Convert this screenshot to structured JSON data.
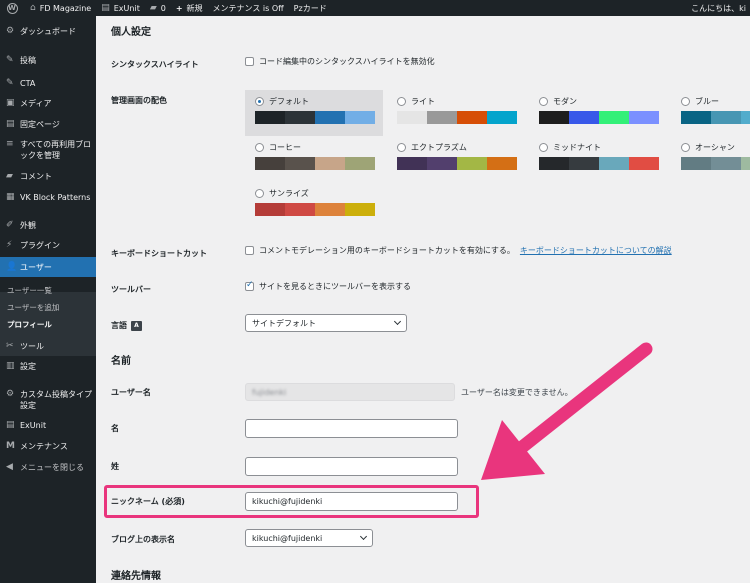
{
  "adminbar": {
    "site_name": "FD Magazine",
    "exunit": "ExUnit",
    "comments_count": "0",
    "new_label": "新規",
    "maintenance": "メンテナンス is Off",
    "pz": "Pzカード",
    "greeting": "こんにちは、ki"
  },
  "sidebar": {
    "items": [
      {
        "label": "ダッシュボード",
        "icon": "dashboard-icon",
        "glyph": "⚙"
      },
      {
        "label": "投稿",
        "icon": "pin-icon",
        "glyph": "✎"
      },
      {
        "label": "CTA",
        "icon": "pin-icon",
        "glyph": "✎"
      },
      {
        "label": "メディア",
        "icon": "media-icon",
        "glyph": "▣"
      },
      {
        "label": "固定ページ",
        "icon": "page-icon",
        "glyph": "▤"
      },
      {
        "label": "すべての再利用ブロックを管理",
        "icon": "blocks-icon",
        "glyph": "≡"
      },
      {
        "label": "コメント",
        "icon": "comment-icon",
        "glyph": "▰"
      },
      {
        "label": "VK Block Patterns",
        "icon": "patterns-icon",
        "glyph": "▦"
      },
      {
        "label": "外観",
        "icon": "appearance-icon",
        "glyph": "✐"
      },
      {
        "label": "プラグイン",
        "icon": "plugin-icon",
        "glyph": "⚡"
      },
      {
        "label": "ユーザー",
        "icon": "user-icon",
        "glyph": "👤"
      },
      {
        "label": "ツール",
        "icon": "tools-icon",
        "glyph": "✂"
      },
      {
        "label": "設定",
        "icon": "settings-icon",
        "glyph": "▥"
      },
      {
        "label": "カスタム投稿タイプ設定",
        "icon": "cpt-icon",
        "glyph": "⚙"
      },
      {
        "label": "ExUnit",
        "icon": "exunit-icon",
        "glyph": "▤"
      },
      {
        "label": "メンテナンス",
        "icon": "maintenance-icon",
        "glyph": "M"
      },
      {
        "label": "メニューを閉じる",
        "icon": "collapse-icon",
        "glyph": "◀"
      }
    ],
    "submenu": [
      "ユーザー一覧",
      "ユーザーを追加",
      "プロフィール"
    ]
  },
  "profile": {
    "section_personal": "個人設定",
    "syntax_label": "シンタックスハイライト",
    "syntax_option": "コード編集中のシンタックスハイライトを無効化",
    "color_label": "管理画面の配色",
    "schemes": [
      {
        "name": "デフォルト",
        "selected": true,
        "colors": [
          "#1d2327",
          "#2c3338",
          "#2271b1",
          "#72aee6"
        ]
      },
      {
        "name": "ライト",
        "selected": false,
        "colors": [
          "#e5e5e5",
          "#999999",
          "#d64e07",
          "#04a4cc"
        ]
      },
      {
        "name": "モダン",
        "selected": false,
        "colors": [
          "#1e1e1e",
          "#3858e9",
          "#33f078",
          "#7b90ff"
        ]
      },
      {
        "name": "ブルー",
        "selected": false,
        "colors": [
          "#096484",
          "#4796b3",
          "#52accc",
          "#74b6ce"
        ]
      },
      {
        "name": "コーヒー",
        "selected": false,
        "colors": [
          "#46403c",
          "#59524c",
          "#c7a589",
          "#9ea476"
        ]
      },
      {
        "name": "エクトプラズム",
        "selected": false,
        "colors": [
          "#413256",
          "#523f6d",
          "#a3b745",
          "#d46f15"
        ]
      },
      {
        "name": "ミッドナイト",
        "selected": false,
        "colors": [
          "#25282b",
          "#363b3f",
          "#69a8bb",
          "#e14d43"
        ]
      },
      {
        "name": "オーシャン",
        "selected": false,
        "colors": [
          "#627c83",
          "#738e96",
          "#9ebaa0",
          "#aa9d88"
        ]
      },
      {
        "name": "サンライズ",
        "selected": false,
        "colors": [
          "#b43c38",
          "#cf4944",
          "#dd823b",
          "#ccaf0b"
        ]
      }
    ],
    "keyboard_label": "キーボードショートカット",
    "keyboard_option": "コメントモデレーション用のキーボードショートカットを有効にする。",
    "keyboard_link": "キーボードショートカットについての解説",
    "toolbar_label": "ツールバー",
    "toolbar_option": "サイトを見るときにツールバーを表示する",
    "language_label": "言語",
    "language_value": "サイトデフォルト",
    "section_name": "名前",
    "username_label": "ユーザー名",
    "username_value": "fujidenki",
    "username_note": "ユーザー名は変更できません。",
    "firstname_label": "名",
    "lastname_label": "姓",
    "nickname_label": "ニックネーム (必須)",
    "nickname_value": "kikuchi@fujidenki",
    "display_label": "ブログ上の表示名",
    "display_value": "kikuchi@fujidenki",
    "section_contact": "連絡先情報"
  },
  "colors": {
    "accent": "#2271b1",
    "highlight": "#e9357d",
    "sidebar_bg": "#1d2327"
  }
}
